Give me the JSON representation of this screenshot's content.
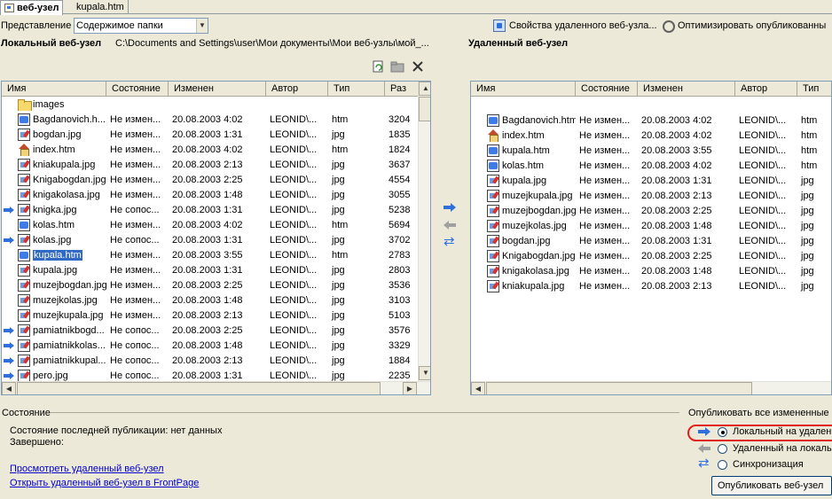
{
  "tabs": [
    {
      "label": "веб-узел",
      "active": true
    },
    {
      "label": "kupala.htm",
      "active": false
    }
  ],
  "toolbar": {
    "view_label": "Представление",
    "view_value": "Содержимое папки",
    "remote_props_label": "Свойства удаленного веб-узла...",
    "optimize_label": "Оптимизировать опубликованны"
  },
  "local": {
    "title": "Локальный веб-узел",
    "path": "C:\\Documents and Settings\\user\\Мои документы\\Мои веб-узлы\\мой_...",
    "columns": [
      "Имя",
      "Состояние",
      "Изменен",
      "Автор",
      "Тип",
      "Раз"
    ],
    "rows": [
      {
        "icon": "folder",
        "name": "images",
        "status": "",
        "modified": "",
        "author": "",
        "type": "",
        "size": "",
        "arrow": false,
        "selected": false
      },
      {
        "icon": "htm",
        "name": "Bagdanovich.h...",
        "status": "Не измен...",
        "modified": "20.08.2003 4:02",
        "author": "LEONID\\...",
        "type": "htm",
        "size": "3204",
        "arrow": false,
        "selected": false
      },
      {
        "icon": "jpg",
        "name": "bogdan.jpg",
        "status": "Не измен...",
        "modified": "20.08.2003 1:31",
        "author": "LEONID\\...",
        "type": "jpg",
        "size": "1835",
        "arrow": false,
        "selected": false
      },
      {
        "icon": "home",
        "name": "index.htm",
        "status": "Не измен...",
        "modified": "20.08.2003 4:02",
        "author": "LEONID\\...",
        "type": "htm",
        "size": "1824",
        "arrow": false,
        "selected": false
      },
      {
        "icon": "jpg",
        "name": "kniakupala.jpg",
        "status": "Не измен...",
        "modified": "20.08.2003 2:13",
        "author": "LEONID\\...",
        "type": "jpg",
        "size": "3637",
        "arrow": false,
        "selected": false
      },
      {
        "icon": "jpg",
        "name": "Knigabogdan.jpg",
        "status": "Не измен...",
        "modified": "20.08.2003 2:25",
        "author": "LEONID\\...",
        "type": "jpg",
        "size": "4554",
        "arrow": false,
        "selected": false
      },
      {
        "icon": "jpg",
        "name": "knigakolasa.jpg",
        "status": "Не измен...",
        "modified": "20.08.2003 1:48",
        "author": "LEONID\\...",
        "type": "jpg",
        "size": "3055",
        "arrow": false,
        "selected": false
      },
      {
        "icon": "jpg",
        "name": "knigka.jpg",
        "status": "Не сопос...",
        "modified": "20.08.2003 1:31",
        "author": "LEONID\\...",
        "type": "jpg",
        "size": "5238",
        "arrow": true,
        "selected": false
      },
      {
        "icon": "htm",
        "name": "kolas.htm",
        "status": "Не измен...",
        "modified": "20.08.2003 4:02",
        "author": "LEONID\\...",
        "type": "htm",
        "size": "5694",
        "arrow": false,
        "selected": false
      },
      {
        "icon": "jpg",
        "name": "kolas.jpg",
        "status": "Не сопос...",
        "modified": "20.08.2003 1:31",
        "author": "LEONID\\...",
        "type": "jpg",
        "size": "3702",
        "arrow": true,
        "selected": false
      },
      {
        "icon": "htm",
        "name": "kupala.htm",
        "status": "Не измен...",
        "modified": "20.08.2003 3:55",
        "author": "LEONID\\...",
        "type": "htm",
        "size": "2783",
        "arrow": false,
        "selected": true
      },
      {
        "icon": "jpg",
        "name": "kupala.jpg",
        "status": "Не измен...",
        "modified": "20.08.2003 1:31",
        "author": "LEONID\\...",
        "type": "jpg",
        "size": "2803",
        "arrow": false,
        "selected": false
      },
      {
        "icon": "jpg",
        "name": "muzejbogdan.jpg",
        "status": "Не измен...",
        "modified": "20.08.2003 2:25",
        "author": "LEONID\\...",
        "type": "jpg",
        "size": "3536",
        "arrow": false,
        "selected": false
      },
      {
        "icon": "jpg",
        "name": "muzejkolas.jpg",
        "status": "Не измен...",
        "modified": "20.08.2003 1:48",
        "author": "LEONID\\...",
        "type": "jpg",
        "size": "3103",
        "arrow": false,
        "selected": false
      },
      {
        "icon": "jpg",
        "name": "muzejkupala.jpg",
        "status": "Не измен...",
        "modified": "20.08.2003 2:13",
        "author": "LEONID\\...",
        "type": "jpg",
        "size": "5103",
        "arrow": false,
        "selected": false
      },
      {
        "icon": "jpg",
        "name": "pamiatnikbogd...",
        "status": "Не сопос...",
        "modified": "20.08.2003 2:25",
        "author": "LEONID\\...",
        "type": "jpg",
        "size": "3576",
        "arrow": true,
        "selected": false
      },
      {
        "icon": "jpg",
        "name": "pamiatnikkolas...",
        "status": "Не сопос...",
        "modified": "20.08.2003 1:48",
        "author": "LEONID\\...",
        "type": "jpg",
        "size": "3329",
        "arrow": true,
        "selected": false
      },
      {
        "icon": "jpg",
        "name": "pamiatnikkupal...",
        "status": "Не сопос...",
        "modified": "20.08.2003 2:13",
        "author": "LEONID\\...",
        "type": "jpg",
        "size": "1884",
        "arrow": true,
        "selected": false
      },
      {
        "icon": "jpg",
        "name": "pero.jpg",
        "status": "Не сопос...",
        "modified": "20.08.2003 1:31",
        "author": "LEONID\\...",
        "type": "jpg",
        "size": "2235",
        "arrow": true,
        "selected": false
      }
    ]
  },
  "remote": {
    "title": "Удаленный веб-узел",
    "columns": [
      "Имя",
      "Состояние",
      "Изменен",
      "Автор",
      "Тип"
    ],
    "rows": [
      {
        "icon": "htm",
        "name": "Bagdanovich.htm",
        "status": "Не измен...",
        "modified": "20.08.2003 4:02",
        "author": "LEONID\\...",
        "type": "htm"
      },
      {
        "icon": "home",
        "name": "index.htm",
        "status": "Не измен...",
        "modified": "20.08.2003 4:02",
        "author": "LEONID\\...",
        "type": "htm"
      },
      {
        "icon": "htm",
        "name": "kupala.htm",
        "status": "Не измен...",
        "modified": "20.08.2003 3:55",
        "author": "LEONID\\...",
        "type": "htm"
      },
      {
        "icon": "htm",
        "name": "kolas.htm",
        "status": "Не измен...",
        "modified": "20.08.2003 4:02",
        "author": "LEONID\\...",
        "type": "htm"
      },
      {
        "icon": "jpg",
        "name": "kupala.jpg",
        "status": "Не измен...",
        "modified": "20.08.2003 1:31",
        "author": "LEONID\\...",
        "type": "jpg"
      },
      {
        "icon": "jpg",
        "name": "muzejkupala.jpg",
        "status": "Не измен...",
        "modified": "20.08.2003 2:13",
        "author": "LEONID\\...",
        "type": "jpg"
      },
      {
        "icon": "jpg",
        "name": "muzejbogdan.jpg",
        "status": "Не измен...",
        "modified": "20.08.2003 2:25",
        "author": "LEONID\\...",
        "type": "jpg"
      },
      {
        "icon": "jpg",
        "name": "muzejkolas.jpg",
        "status": "Не измен...",
        "modified": "20.08.2003 1:48",
        "author": "LEONID\\...",
        "type": "jpg"
      },
      {
        "icon": "jpg",
        "name": "bogdan.jpg",
        "status": "Не измен...",
        "modified": "20.08.2003 1:31",
        "author": "LEONID\\...",
        "type": "jpg"
      },
      {
        "icon": "jpg",
        "name": "Knigabogdan.jpg",
        "status": "Не измен...",
        "modified": "20.08.2003 2:25",
        "author": "LEONID\\...",
        "type": "jpg"
      },
      {
        "icon": "jpg",
        "name": "knigakolasa.jpg",
        "status": "Не измен...",
        "modified": "20.08.2003 1:48",
        "author": "LEONID\\...",
        "type": "jpg"
      },
      {
        "icon": "jpg",
        "name": "kniakupala.jpg",
        "status": "Не измен...",
        "modified": "20.08.2003 2:13",
        "author": "LEONID\\...",
        "type": "jpg"
      }
    ]
  },
  "status": {
    "section_label": "Состояние",
    "last_publish": "Состояние последней публикации: нет данных",
    "completed": "Завершено:",
    "link_view_remote": "Просмотреть удаленный веб-узел",
    "link_open_frontpage": "Открыть удаленный веб-узел в FrontPage"
  },
  "publish": {
    "section_label": "Опубликовать все измененные",
    "options": [
      {
        "label": "Локальный на удален",
        "checked": true,
        "icon": "arrow-right-icon"
      },
      {
        "label": "Удаленный на локаль",
        "checked": false,
        "icon": "arrow-left-icon"
      },
      {
        "label": "Синхронизация",
        "checked": false,
        "icon": "sync-arrows-icon"
      }
    ],
    "button_label": "Опубликовать веб-узел"
  }
}
